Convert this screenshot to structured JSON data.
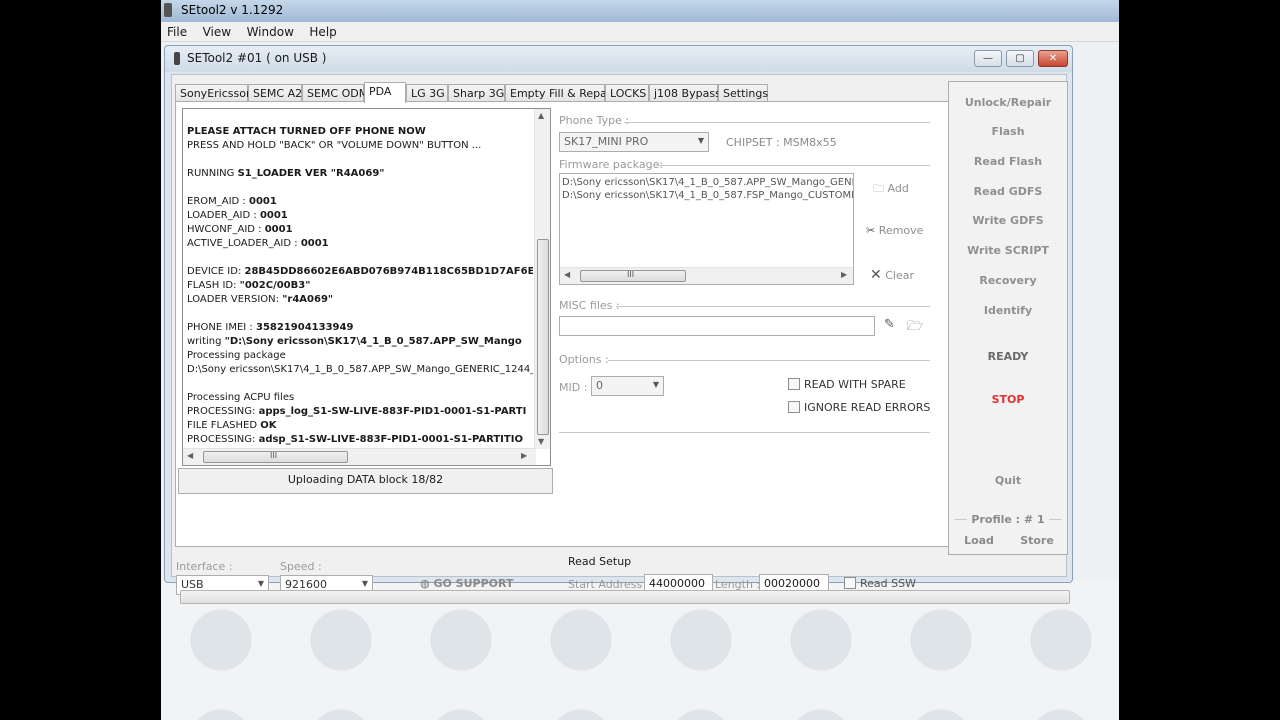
{
  "app": {
    "title": "SEtool2 v 1.1292"
  },
  "menu": [
    "File",
    "View",
    "Window",
    "Help"
  ],
  "window": {
    "title": "SETool2 #01 ( on USB )",
    "min": "—",
    "max": "▢",
    "close": "✕"
  },
  "tabs": [
    "SonyEricsson",
    "SEMC A2",
    "SEMC ODM",
    "PDA",
    "LG 3G",
    "Sharp 3G",
    "Empty Fill & Repair",
    "LOCKS",
    "j108 Bypass",
    "Settings"
  ],
  "active_tab": "PDA",
  "log": [
    [
      {
        "t": "PLEASE ATTACH TURNED OFF PHONE NOW",
        "b": true
      }
    ],
    [
      {
        "t": "PRESS AND HOLD \"BACK\" OR \"VOLUME DOWN\" BUTTON ..."
      }
    ],
    [],
    [
      {
        "t": "RUNNING "
      },
      {
        "t": "S1_LOADER VER \"R4A069\"",
        "b": true
      }
    ],
    [],
    [
      {
        "t": "EROM_AID : "
      },
      {
        "t": "0001",
        "b": true
      }
    ],
    [
      {
        "t": "LOADER_AID : "
      },
      {
        "t": "0001",
        "b": true
      }
    ],
    [
      {
        "t": "HWCONF_AID : "
      },
      {
        "t": "0001",
        "b": true
      }
    ],
    [
      {
        "t": "ACTIVE_LOADER_AID : "
      },
      {
        "t": "0001",
        "b": true
      }
    ],
    [],
    [
      {
        "t": "DEVICE ID: "
      },
      {
        "t": "28B45DD86602E6ABD076B974B118C65BD1D7AF6E",
        "b": true
      }
    ],
    [
      {
        "t": "FLASH ID: "
      },
      {
        "t": "\"002C/00B3\"",
        "b": true
      }
    ],
    [
      {
        "t": "LOADER VERSION: "
      },
      {
        "t": "\"r4A069\"",
        "b": true
      }
    ],
    [],
    [
      {
        "t": "PHONE IMEI : "
      },
      {
        "t": "35821904133949",
        "b": true
      }
    ],
    [
      {
        "t": "writing "
      },
      {
        "t": "\"D:\\Sony ericsson\\SK17\\4_1_B_0_587.APP_SW_Mango",
        "b": true
      }
    ],
    [
      {
        "t": "Processing package"
      }
    ],
    [
      {
        "t": "D:\\Sony ericsson\\SK17\\4_1_B_0_587.APP_SW_Mango_GENERIC_1244_"
      }
    ],
    [],
    [
      {
        "t": "Processing ACPU files"
      }
    ],
    [
      {
        "t": "PROCESSING: "
      },
      {
        "t": "apps_log_S1-SW-LIVE-883F-PID1-0001-S1-PARTI",
        "b": true
      }
    ],
    [
      {
        "t": "FILE FLASHED "
      },
      {
        "t": "OK",
        "b": true
      }
    ],
    [
      {
        "t": "PROCESSING: "
      },
      {
        "t": "adsp_S1-SW-LIVE-883F-PID1-0001-S1-PARTITIO",
        "b": true
      }
    ]
  ],
  "status_text": "Uploading DATA block 18/82",
  "phone_type": {
    "label": "Phone Type :",
    "value": "SK17_MINI PRO"
  },
  "chipset": "CHIPSET : MSM8x55",
  "firmware": {
    "label": "Firmware package:",
    "files": [
      "D:\\Sony ericsson\\SK17\\4_1_B_0_587.APP_SW_Mango_GENE",
      "D:\\Sony ericsson\\SK17\\4_1_B_0_587.FSP_Mango_CUSTOMI"
    ],
    "add": "Add",
    "remove": "Remove",
    "clear": "Clear"
  },
  "misc": {
    "label": "MISC files :",
    "value": ""
  },
  "options": {
    "label": "Options :",
    "mid_label": "MID :",
    "mid_value": "0",
    "read_with_spare": "READ WITH SPARE",
    "ignore_read_errors": "IGNORE READ ERRORS"
  },
  "bottom": {
    "interface_label": "Interface :",
    "interface_value": "USB",
    "speed_label": "Speed :",
    "speed_value": "921600",
    "go_support": "GO SUPPORT",
    "read_setup": "Read Setup",
    "start_address_label": "Start Address :",
    "start_address": "44000000",
    "length_label": "Length :",
    "length": "00020000",
    "read_ssw": "Read SSW"
  },
  "side": {
    "buttons": [
      "Unlock/Repair",
      "Flash",
      "Read Flash",
      "Read GDFS",
      "Write GDFS",
      "Write SCRIPT",
      "Recovery",
      "Identify"
    ],
    "ready": "READY",
    "stop": "STOP",
    "quit": "Quit",
    "profile": "Profile :  # 1",
    "load": "Load",
    "store": "Store"
  },
  "icons": {
    "add": "folder-add-icon",
    "remove": "scissors-icon",
    "clear": "x-icon",
    "misc_edit": "pencil-icon",
    "misc_open": "folder-open-icon",
    "go_support": "globe-icon"
  }
}
